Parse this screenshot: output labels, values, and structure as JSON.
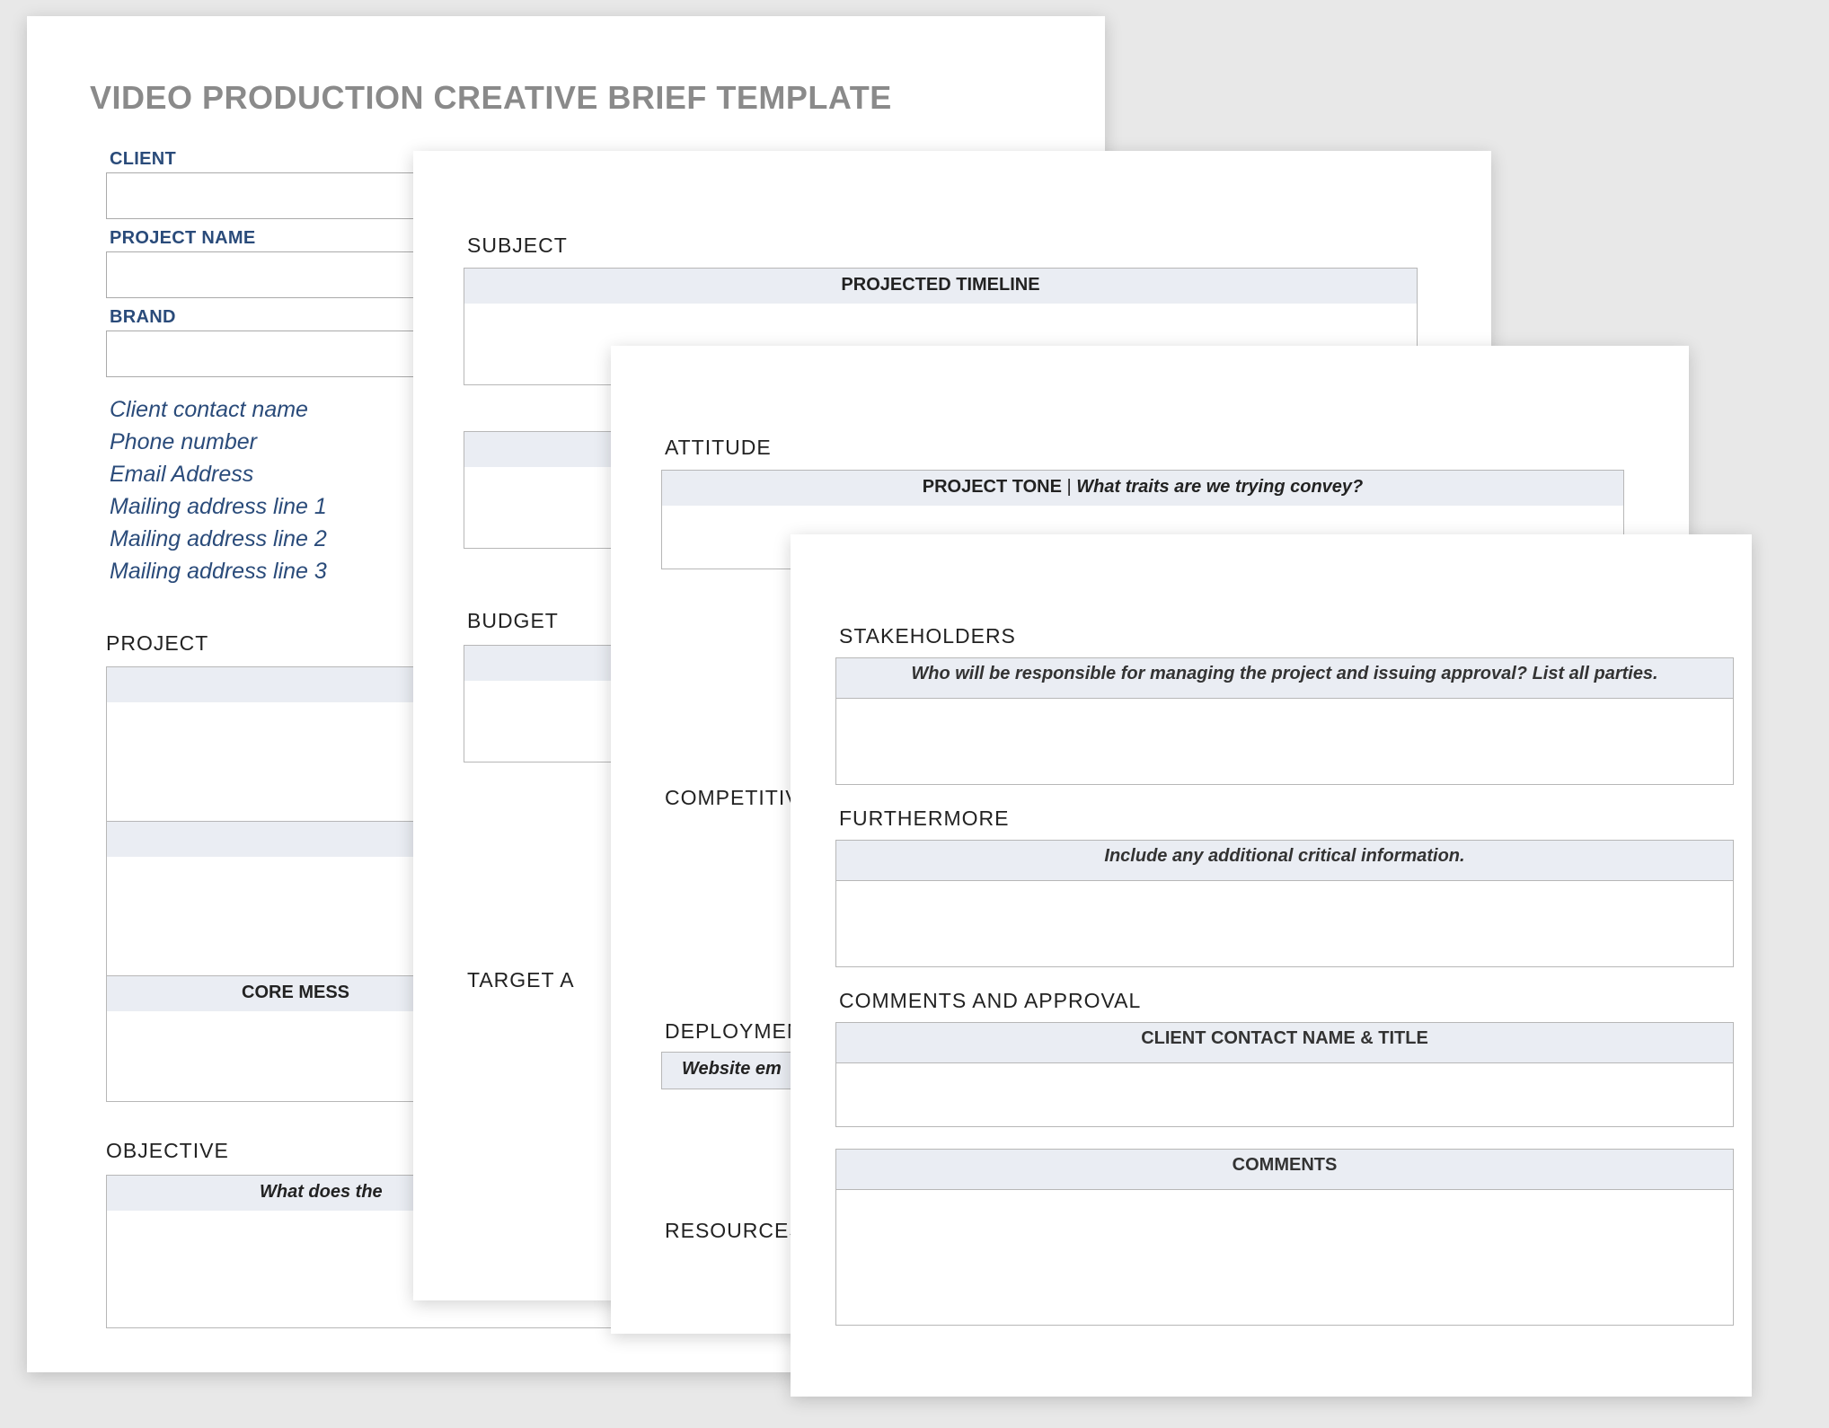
{
  "doc": {
    "title": "VIDEO PRODUCTION CREATIVE BRIEF TEMPLATE"
  },
  "page1": {
    "labels": {
      "client": "CLIENT",
      "project_name": "PROJECT NAME",
      "brand": "BRAND",
      "project": "PROJECT",
      "objective": "OBJECTIVE"
    },
    "contact_placeholders": {
      "name": "Client contact name",
      "phone": "Phone number",
      "email": "Email Address",
      "addr1": "Mailing address line 1",
      "addr2": "Mailing address line 2",
      "addr3": "Mailing address line 3"
    },
    "project_bar3": "CORE MESS",
    "objective_bar": "What does the"
  },
  "page2": {
    "labels": {
      "subject": "SUBJECT",
      "budget": "BUDGET",
      "competitiv": "COMPETITIV",
      "target_a": "TARGET A"
    },
    "subject_bar": "PROJECTED TIMELINE"
  },
  "page3": {
    "labels": {
      "attitude": "ATTITUDE",
      "deploymen": "DEPLOYMEN",
      "resources": "RESOURCES"
    },
    "attitude_bar_bold": "PROJECT TONE",
    "attitude_bar_sep": "  |  ",
    "attitude_bar_italic": "What traits are we trying convey?",
    "deploy_bar": "Website em"
  },
  "page4": {
    "labels": {
      "stakeholders": "STAKEHOLDERS",
      "furthermore": "FURTHERMORE",
      "comments_approval": "COMMENTS AND APPROVAL"
    },
    "stakeholders_bar": "Who will be responsible for managing the project and issuing approval? List all parties.",
    "furthermore_bar": "Include any additional critical information.",
    "cc_name_bar": "CLIENT CONTACT NAME & TITLE",
    "comments_bar": "COMMENTS"
  }
}
